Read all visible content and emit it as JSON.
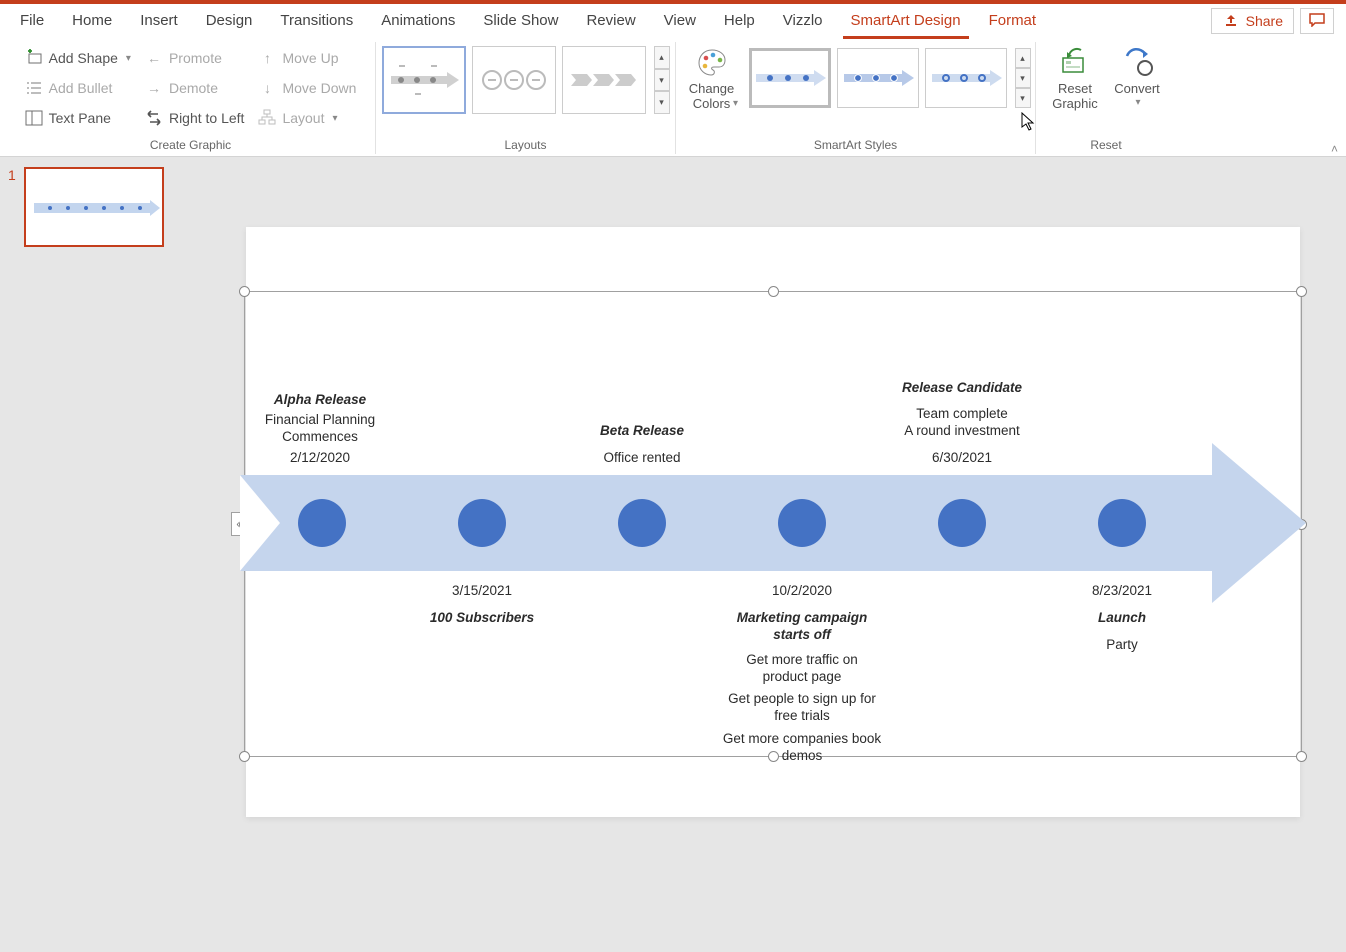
{
  "tabs": [
    "File",
    "Home",
    "Insert",
    "Design",
    "Transitions",
    "Animations",
    "Slide Show",
    "Review",
    "View",
    "Help",
    "Vizzlo",
    "SmartArt Design",
    "Format"
  ],
  "active_tab": "SmartArt Design",
  "share_label": "Share",
  "ribbon": {
    "create_graphic": {
      "add_shape": "Add Shape",
      "add_bullet": "Add Bullet",
      "text_pane": "Text Pane",
      "promote": "Promote",
      "demote": "Demote",
      "right_to_left": "Right to Left",
      "move_up": "Move Up",
      "move_down": "Move Down",
      "layout": "Layout",
      "label": "Create Graphic"
    },
    "layouts_label": "Layouts",
    "change_colors": "Change\nColors",
    "smartart_styles_label": "SmartArt Styles",
    "reset_graphic": "Reset\nGraphic",
    "convert": "Convert",
    "reset_label": "Reset"
  },
  "thumb": {
    "num": "1"
  },
  "timeline": [
    {
      "pos": "above",
      "title": "Alpha Release",
      "lines": [
        "Financial Planning",
        "Commences"
      ],
      "date": "2/12/2020"
    },
    {
      "pos": "below",
      "title": "100 Subscribers",
      "lines": [],
      "date": "3/15/2021"
    },
    {
      "pos": "above",
      "title": "Beta Release",
      "lines": [
        "Office rented"
      ],
      "date": ""
    },
    {
      "pos": "below",
      "title": "Marketing campaign starts off",
      "lines": [
        "Get more traffic on product page",
        "Get people to sign up for free trials",
        "Get more companies book demos"
      ],
      "date": "10/2/2020"
    },
    {
      "pos": "above",
      "title": "Release Candidate",
      "lines": [
        "Team complete",
        "A round investment"
      ],
      "date": "6/30/2021"
    },
    {
      "pos": "below",
      "title": "Launch",
      "lines": [
        "Party"
      ],
      "date": "8/23/2021"
    }
  ]
}
